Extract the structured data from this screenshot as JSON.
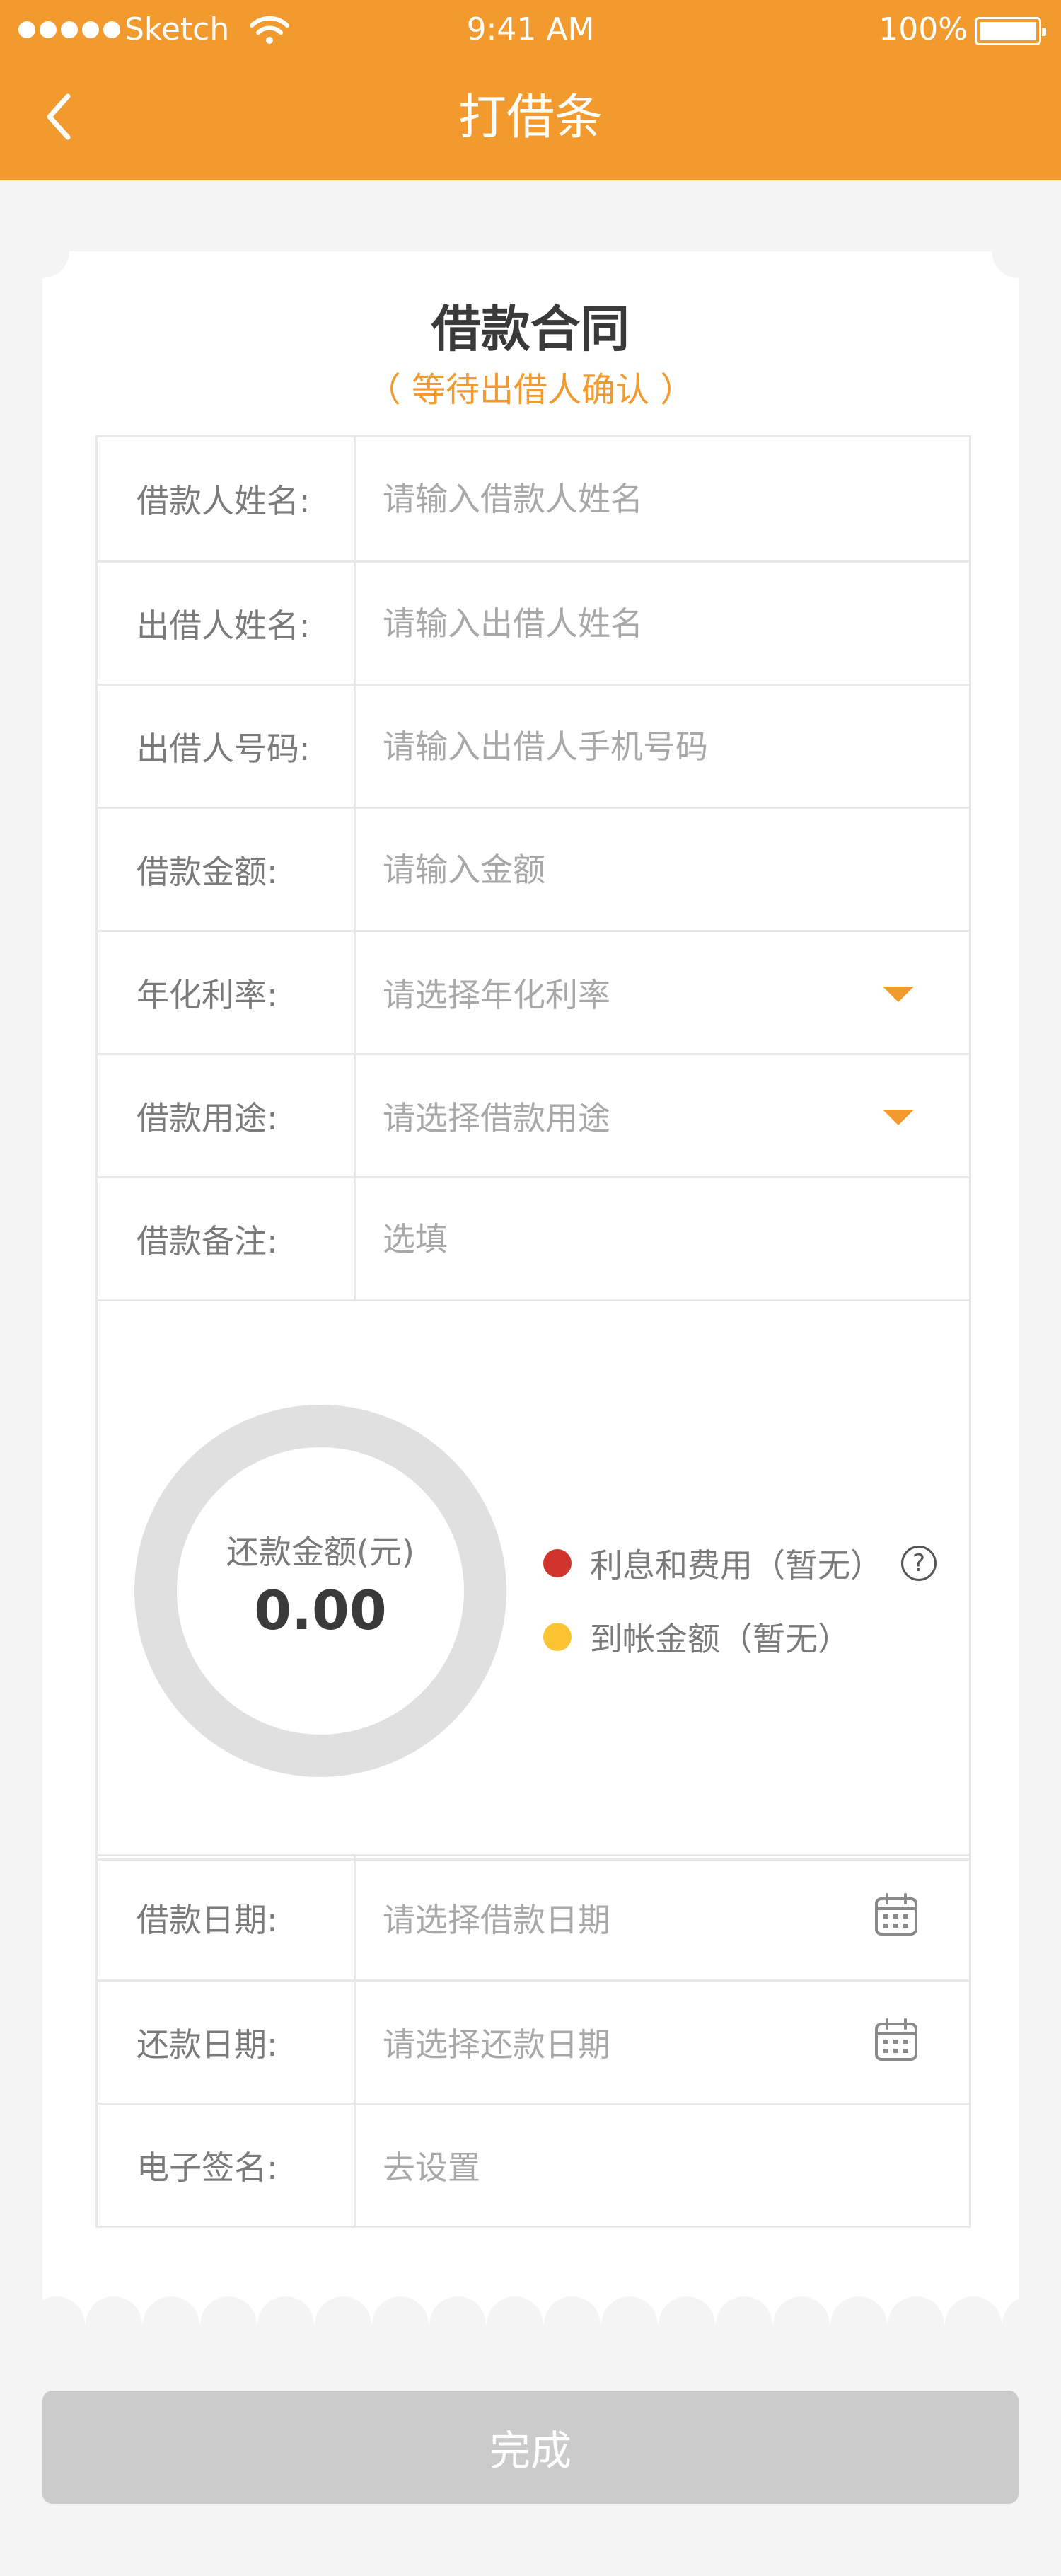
{
  "status_bar": {
    "carrier": "Sketch",
    "time": "9:41 AM",
    "battery": "100%"
  },
  "nav": {
    "title": "打借条",
    "back_icon": "chevron-left-icon"
  },
  "contract": {
    "title": "借款合同",
    "status": "（ 等待出借人确认 ）"
  },
  "form_top": [
    {
      "label": "借款人姓名:",
      "placeholder": "请输入借款人姓名",
      "value": "",
      "kind": "input"
    },
    {
      "label": "出借人姓名:",
      "placeholder": "请输入出借人姓名",
      "value": "",
      "kind": "input"
    },
    {
      "label": "出借人号码:",
      "placeholder": "请输入出借人手机号码",
      "value": "",
      "kind": "input"
    },
    {
      "label": "借款金额:",
      "placeholder": "请输入金额",
      "value": "",
      "kind": "input"
    },
    {
      "label": "年化利率:",
      "placeholder": "请选择年化利率",
      "value": "",
      "kind": "select"
    },
    {
      "label": "借款用途:",
      "placeholder": "请选择借款用途",
      "value": "",
      "kind": "select"
    },
    {
      "label": "借款备注:",
      "placeholder": "选填",
      "value": "",
      "kind": "input"
    }
  ],
  "summary": {
    "ring_label": "还款金额(元)",
    "amount": "0.00",
    "ring_color": "#e0e0e0",
    "legend": [
      {
        "label": "利息和费用（暂无）",
        "color": "#d0342c",
        "help": true,
        "help_glyph": "?"
      },
      {
        "label": "到帐金额（暂无）",
        "color": "#fcc433",
        "help": false
      }
    ]
  },
  "form_bottom": [
    {
      "label": "借款日期:",
      "placeholder": "请选择借款日期",
      "kind": "date"
    },
    {
      "label": "还款日期:",
      "placeholder": "请选择还款日期",
      "kind": "date"
    },
    {
      "label": "电子签名:",
      "placeholder": "去设置",
      "kind": "link"
    }
  ],
  "submit": {
    "label": "完成"
  },
  "colors": {
    "brand": "#f39a2e",
    "disabled_button": "#cbcbcb",
    "background": "#f4f4f4"
  }
}
